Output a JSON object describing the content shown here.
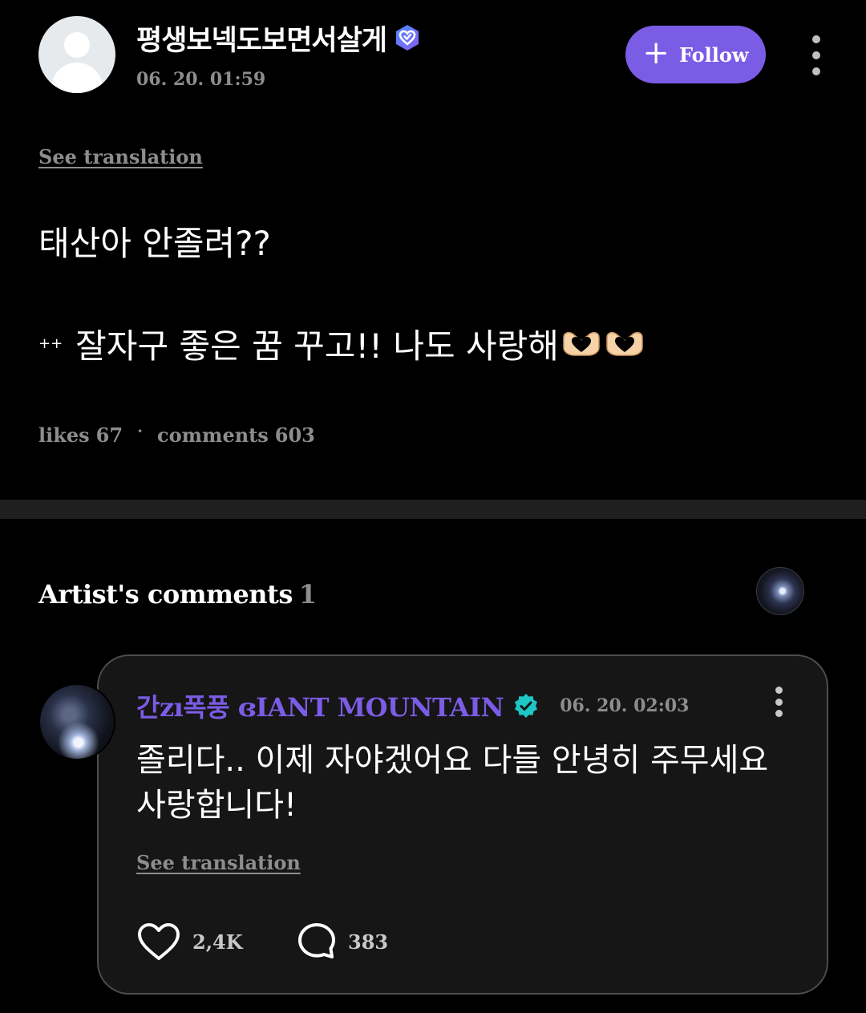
{
  "post": {
    "author": "평생보넥도보면서살게",
    "date": "06. 20. 01:59",
    "follow_label": "Follow",
    "see_translation": "See translation",
    "body_line1": "태산아 안졸려??",
    "body_line2_prefix": "++",
    "body_line2": "잘자구 좋은 꿈 꾸고!! 나도 사랑해",
    "stats": {
      "likes_label": "likes",
      "likes": "67",
      "separator": "·",
      "comments_label": "comments",
      "comments": "603"
    }
  },
  "artist_comments": {
    "title": "Artist's comments",
    "count": "1",
    "comment": {
      "author": "간zı폭풍 ɞIANT MOUNTAIN",
      "date": "06. 20. 02:03",
      "text": "졸리다.. 이제 자야겠어요 다들 안녕히 주무세요\n사랑합니다!",
      "see_translation": "See translation",
      "likes": "2,4K",
      "replies": "383"
    }
  },
  "colors": {
    "background": "#000000",
    "accent": "#7b5ce5",
    "card": "#161616",
    "muted_text": "#8d8d8d",
    "verified_badge": "#1ec6c6"
  },
  "icons": [
    "verified-heart-icon",
    "plus-icon",
    "more-vertical-icon",
    "hand-heart-emoji-icon",
    "verified-check-icon",
    "heart-outline-icon",
    "comment-bubble-icon"
  ]
}
